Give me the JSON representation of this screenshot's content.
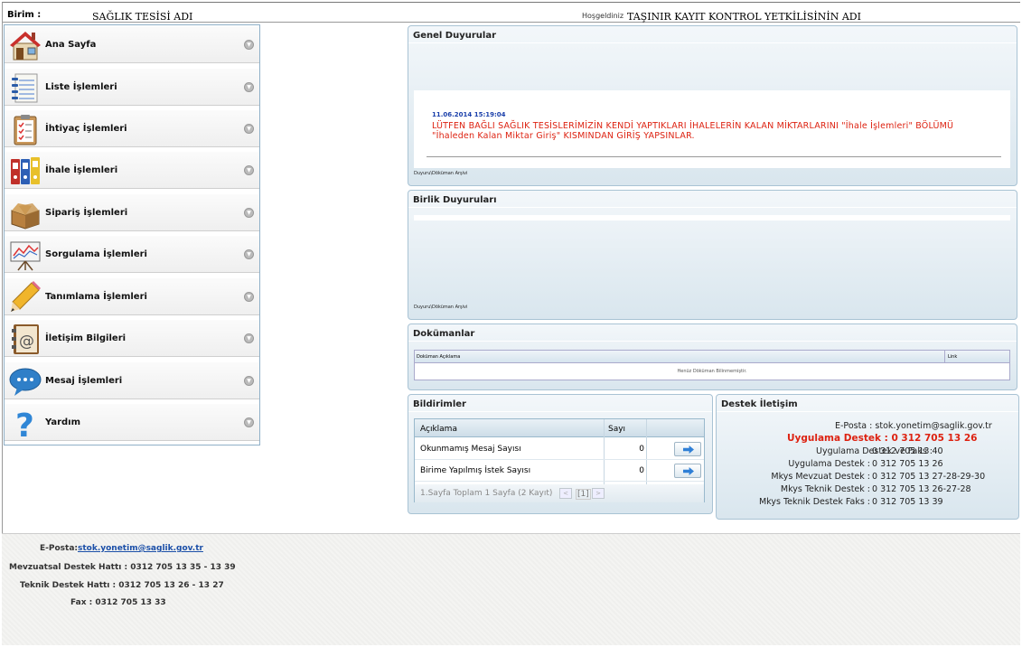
{
  "header": {
    "birim_label": "Birim :",
    "birim_value": "SAĞLIK TESİSİ ADI",
    "welcome_text": "Hoşgeldiniz",
    "user_name": "TAŞINIR KAYIT KONTROL YETKİLİSİNİN ADI"
  },
  "sidebar": {
    "items": [
      {
        "label": "Ana Sayfa",
        "icon": "home-icon"
      },
      {
        "label": "Liste İşlemleri",
        "icon": "notebook-icon"
      },
      {
        "label": "İhtiyaç İşlemleri",
        "icon": "clipboard-checklist-icon"
      },
      {
        "label": "İhale İşlemleri",
        "icon": "binders-icon"
      },
      {
        "label": "Sipariş İşlemleri",
        "icon": "open-box-icon"
      },
      {
        "label": "Sorgulama İşlemleri",
        "icon": "chart-easel-icon"
      },
      {
        "label": "Tanımlama İşlemleri",
        "icon": "pencil-icon"
      },
      {
        "label": "İletişim Bilgileri",
        "icon": "address-book-icon"
      },
      {
        "label": "Mesaj İşlemleri",
        "icon": "speech-bubble-icon"
      },
      {
        "label": "Yardım",
        "icon": "question-mark-icon"
      }
    ]
  },
  "genel_duyurular": {
    "title": "Genel Duyurular",
    "date": "11.06.2014 15:19:04",
    "message": "LÜTFEN BAĞLI SAĞLIK TESİSLERİMİZİN KENDİ YAPTIKLARI İHALELERİN KALAN MİKTARLARINI \"İhale İşlemleri\" BÖLÜMÜ \"İhaleden Kalan Miktar Giriş\" KISMINDAN GİRİŞ YAPSINLAR.",
    "archive_link": "Duyuru\\Döküman Arşivi"
  },
  "birlik_duyurulari": {
    "title": "Birlik Duyuruları",
    "archive_link": "Duyuru\\Döküman Arşivi"
  },
  "dokumanlar": {
    "title": "Dokümanlar",
    "col_description": "Doküman Açıklama",
    "col_link": "Link",
    "empty_text": "Henüz Döküman Bilinmemiştir."
  },
  "bildirimler": {
    "title": "Bildirimler",
    "col_aciklama": "Açıklama",
    "col_sayi": "Sayı",
    "rows": [
      {
        "label": "Okunmamış Mesaj Sayısı",
        "count": "0"
      },
      {
        "label": "Birime Yapılmış İstek Sayısı",
        "count": "0"
      }
    ],
    "page_info": "1.Sayfa Toplam 1 Sayfa (2 Kayıt)",
    "prev": "<",
    "current_page": "[1]",
    "next": ">"
  },
  "destek": {
    "title": "Destek İletişim",
    "email_label": "E-Posta :",
    "email_value": "stok.yonetim@saglik.gov.tr",
    "uygulama_destek": "Uygulama Destek : 0 312 705 13 26",
    "lines": [
      {
        "label": "Uygulama Destek ve Faks :",
        "value": "0 312 705 13 40"
      },
      {
        "label": "Uygulama Destek :",
        "value": "0 312 705 13 26"
      },
      {
        "label": "Mkys Mevzuat Destek :",
        "value": "0 312 705 13 27-28-29-30"
      },
      {
        "label": "Mkys Teknik Destek :",
        "value": "0 312 705 13 26-27-28"
      },
      {
        "label": "Mkys Teknik Destek Faks :",
        "value": "0 312 705 13 39"
      }
    ]
  },
  "footer": {
    "email_label": "E-Posta:",
    "email_value": "stok.yonetim@saglik.gov.tr",
    "mevzuat": "Mevzuatsal Destek Hattı : 0312 705 13 35 - 13 39",
    "teknik": "Teknik Destek Hattı : 0312 705 13 26 - 13 27",
    "fax": "Fax : 0312 705 13 33"
  }
}
